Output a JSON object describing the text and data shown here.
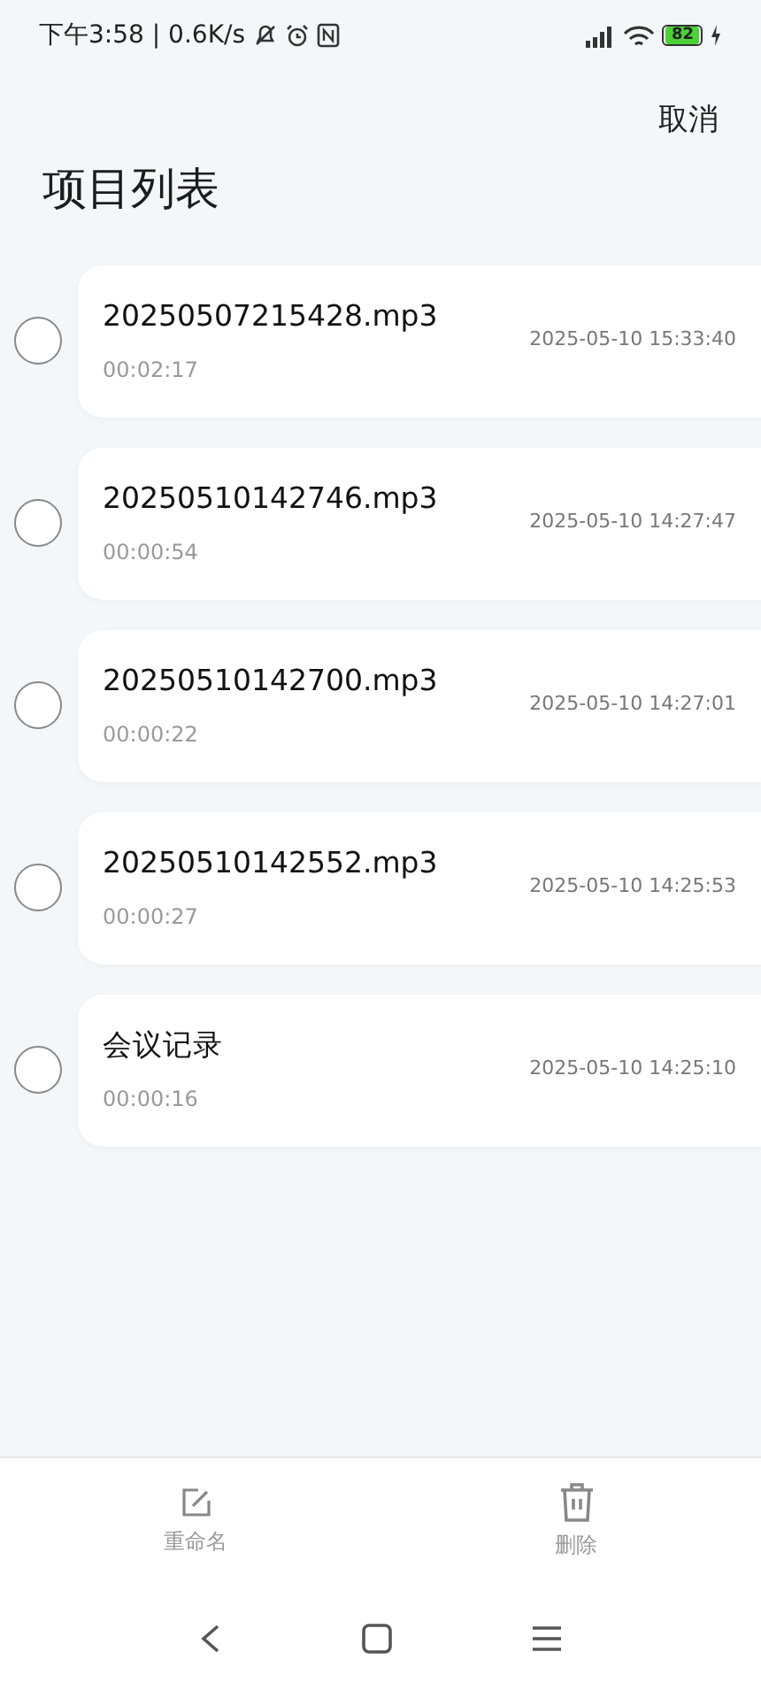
{
  "status_bar": {
    "time": "下午3:58 | 0.6K/s",
    "battery": "82"
  },
  "header": {
    "cancel": "取消",
    "title": "项目列表"
  },
  "items": [
    {
      "name": "20250507215428.mp3",
      "duration": "00:02:17",
      "date": "2025-05-10 15:33:40",
      "selected": false
    },
    {
      "name": "20250510142746.mp3",
      "duration": "00:00:54",
      "date": "2025-05-10 14:27:47",
      "selected": false
    },
    {
      "name": "20250510142700.mp3",
      "duration": "00:00:22",
      "date": "2025-05-10 14:27:01",
      "selected": false
    },
    {
      "name": "20250510142552.mp3",
      "duration": "00:00:27",
      "date": "2025-05-10 14:25:53",
      "selected": false
    },
    {
      "name": "会议记录",
      "duration": "00:00:16",
      "date": "2025-05-10 14:25:10",
      "selected": false
    }
  ],
  "toolbar": [
    {
      "kind": "rename",
      "label": "重命名",
      "disabled": true
    },
    {
      "kind": "delete",
      "label": "删除",
      "disabled": true
    }
  ]
}
